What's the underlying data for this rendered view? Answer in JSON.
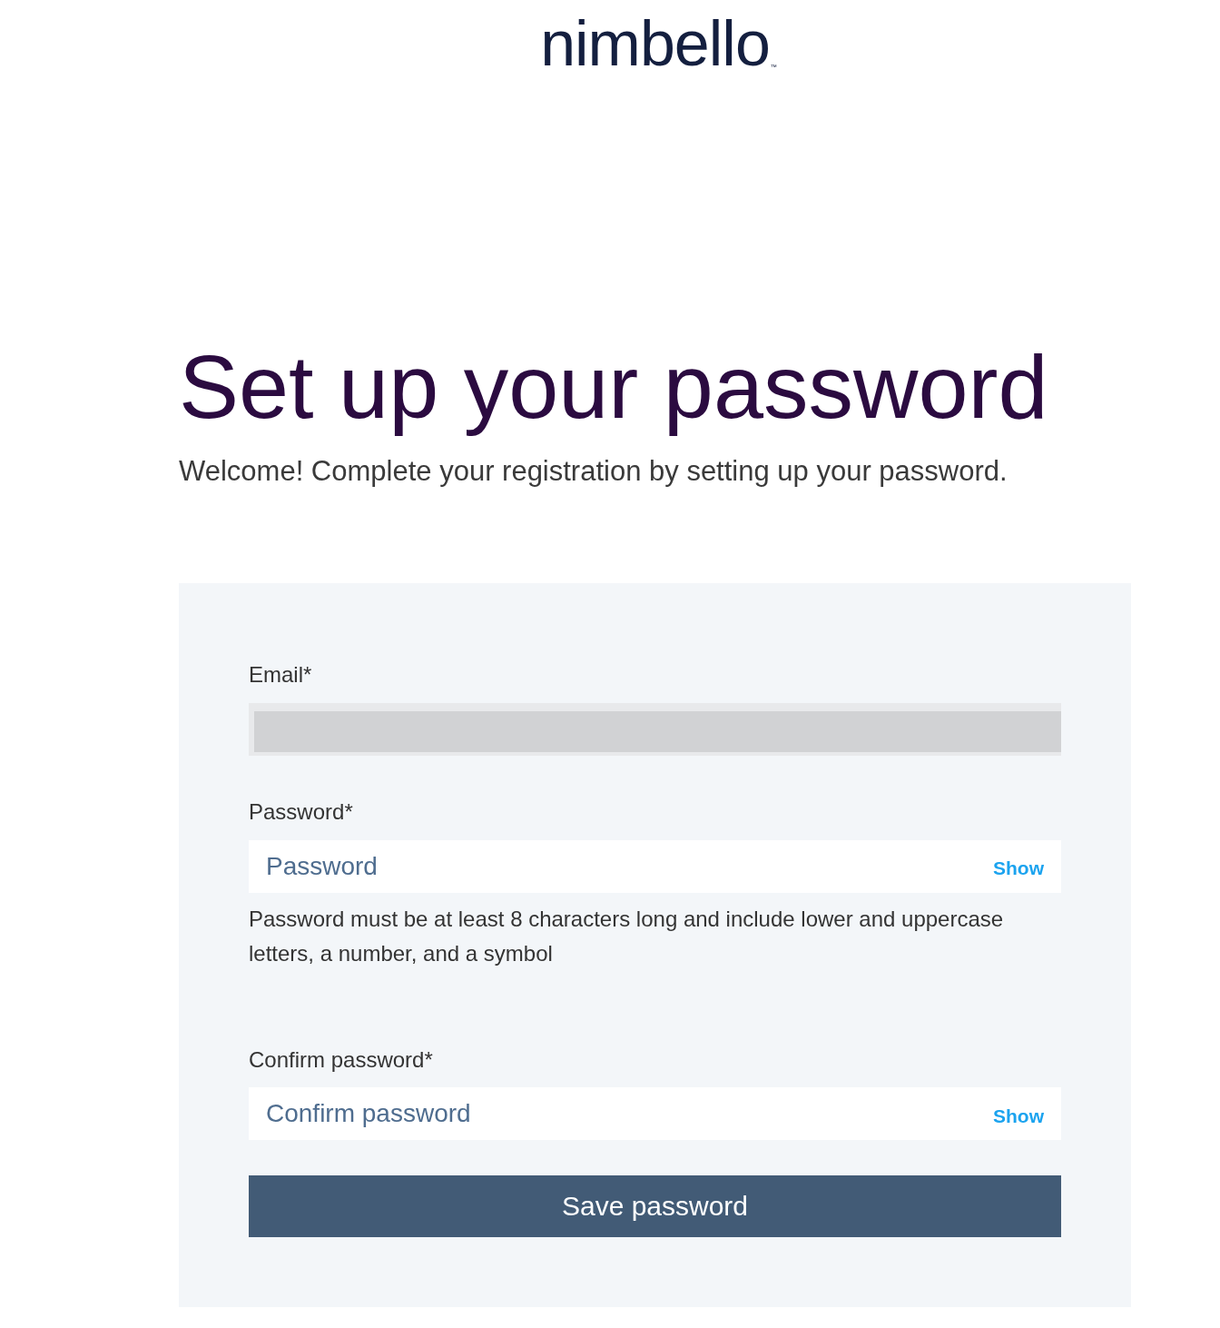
{
  "logo": {
    "text": "nimbello",
    "mark": "™"
  },
  "heading": "Set up your password",
  "subtitle": "Welcome! Complete your registration by setting up your password.",
  "form": {
    "fields": [
      {
        "kind": "email",
        "label": "Email*",
        "disabled": true
      },
      {
        "kind": "password",
        "label": "Password*",
        "placeholder": "Password",
        "toggle": "Show",
        "help": "Password must be at least 8 characters long and include lower and uppercase letters, a number, and a symbol"
      },
      {
        "kind": "password",
        "label": "Confirm password*",
        "placeholder": "Confirm password",
        "toggle": "Show"
      }
    ],
    "submit": "Save password"
  }
}
